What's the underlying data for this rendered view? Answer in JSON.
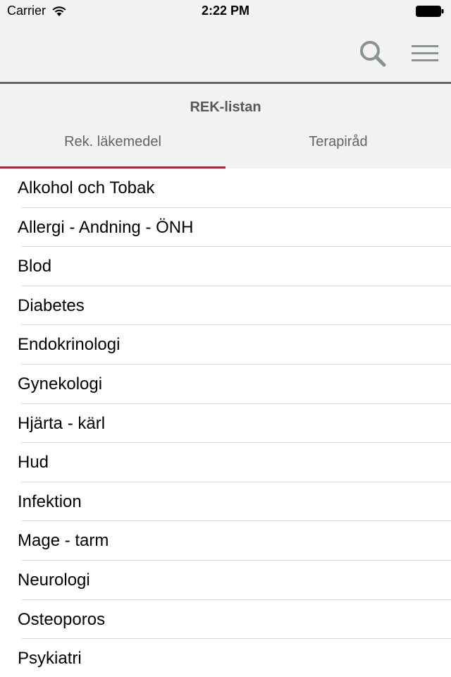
{
  "status_bar": {
    "carrier": "Carrier",
    "time": "2:22 PM",
    "wifi_icon": "wifi-icon",
    "battery_icon": "battery-icon"
  },
  "nav": {
    "search_icon": "search-icon",
    "menu_icon": "hamburger-menu-icon"
  },
  "header": {
    "title": "REK-listan",
    "tabs": [
      {
        "label": "Rek. läkemedel",
        "active": true
      },
      {
        "label": "Terapiråd",
        "active": false
      }
    ]
  },
  "list": {
    "items": [
      {
        "label": "Alkohol och Tobak"
      },
      {
        "label": "Allergi - Andning - ÖNH"
      },
      {
        "label": "Blod"
      },
      {
        "label": "Diabetes"
      },
      {
        "label": "Endokrinologi"
      },
      {
        "label": "Gynekologi"
      },
      {
        "label": "Hjärta - kärl"
      },
      {
        "label": "Hud"
      },
      {
        "label": "Infektion"
      },
      {
        "label": "Mage - tarm"
      },
      {
        "label": "Neurologi"
      },
      {
        "label": "Osteoporos"
      },
      {
        "label": "Psykiatri"
      }
    ]
  },
  "colors": {
    "bar_background": "#f1f2f1",
    "active_tab_underline": "#9b2d3a",
    "nav_divider": "#5d6663",
    "icon_color": "#8a9390"
  }
}
